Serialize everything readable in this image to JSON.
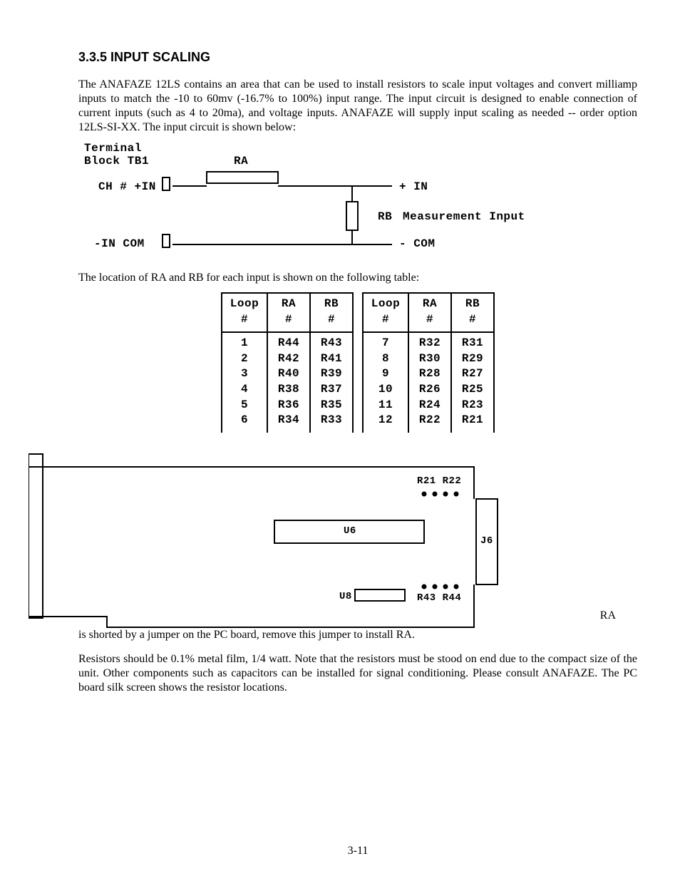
{
  "heading": "3.3.5 INPUT SCALING",
  "para1": "The ANAFAZE 12LS contains an area that can be used to install resistors to scale input voltages and convert milliamp inputs to match the -10 to 60mv (-16.7% to 100%) input range. The input circuit is designed to enable connection of current inputs (such as 4 to 20ma), and voltage inputs.  ANAFAZE will supply input scaling as needed -- order option 12LS-SI-XX.  The input circuit is shown below:",
  "circuit": {
    "terminal_l1": "Terminal",
    "terminal_l2": "Block TB1",
    "ra": "RA",
    "ch_in": "CH # +IN",
    "in_com": "-IN COM",
    "plus_in": "+ IN",
    "rb": "RB",
    "meas": "Measurement Input",
    "minus_com": "- COM"
  },
  "para2": "The location of RA and RB for each input is shown on the following table:",
  "table": {
    "head": {
      "loop": "Loop",
      "hash": "#",
      "ra": "RA",
      "rb": "RB"
    },
    "left": {
      "loop": [
        "1",
        "2",
        "3",
        "4",
        "5",
        "6"
      ],
      "ra": [
        "R44",
        "R42",
        "R40",
        "R38",
        "R36",
        "R34"
      ],
      "rb": [
        "R43",
        "R41",
        "R39",
        "R37",
        "R35",
        "R33"
      ]
    },
    "right": {
      "loop": [
        "7",
        "8",
        "9",
        "10",
        "11",
        "12"
      ],
      "ra": [
        "R32",
        "R30",
        "R28",
        "R26",
        "R24",
        "R22"
      ],
      "rb": [
        "R31",
        "R29",
        "R27",
        "R25",
        "R23",
        "R21"
      ]
    }
  },
  "board": {
    "r21r22": "R21 R22",
    "u6": "U6",
    "j6": "J6",
    "u8": "U8",
    "r43r44": "R43 R44"
  },
  "ra_float": "RA",
  "para3": "is shorted by a jumper on the PC board, remove this jumper to install RA.",
  "para4": "Resistors should be 0.1% metal film, 1/4 watt.  Note that the resistors must be stood on end due to the compact size of the unit.  Other components such as capacitors can be installed for signal conditioning.  Please consult ANAFAZE. The PC board silk screen shows the resistor locations.",
  "pagenum": "3-11"
}
